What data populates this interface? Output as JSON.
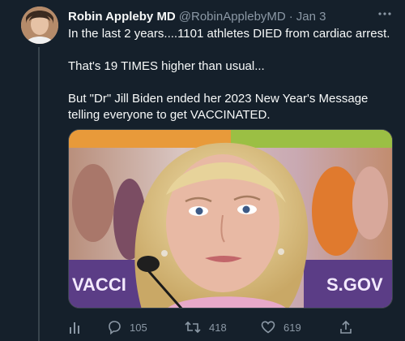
{
  "tweet": {
    "author_name": "Robin Appleby MD",
    "handle": "@RobinApplebyMD",
    "separator": "·",
    "date": "Jan 3",
    "lines": [
      "In the last 2 years....1101 athletes DIED from cardiac arrest.",
      "That's 19 TIMES higher than usual...",
      "But \"Dr\" Jill Biden ended her 2023 New Year's Message telling everyone to get VACCINATED."
    ],
    "image_text": {
      "left": "VACCI",
      "right": "S.GOV"
    }
  },
  "actions": {
    "replies": "105",
    "retweets": "418",
    "likes": "619"
  },
  "icons": {
    "more": "more-icon",
    "analytics": "analytics-icon",
    "reply": "reply-icon",
    "retweet": "retweet-icon",
    "like": "heart-icon",
    "share": "share-icon"
  },
  "colors": {
    "background": "#15202b",
    "text": "#f7f9f9",
    "muted": "#8b98a5",
    "banner_purple": "#5b3d86"
  }
}
